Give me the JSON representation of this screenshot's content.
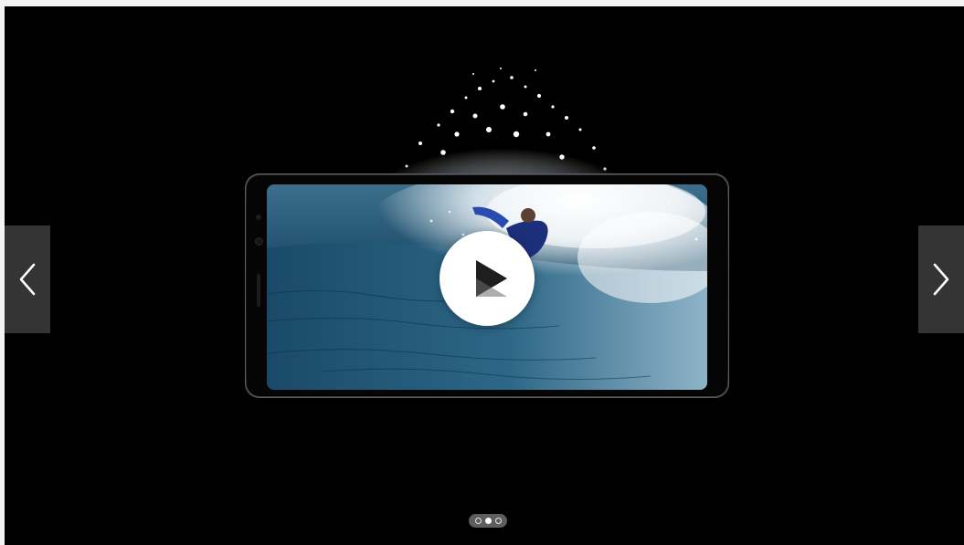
{
  "carousel": {
    "prev_icon": "chevron-left-icon",
    "next_icon": "chevron-right-icon",
    "play_icon": "play-icon",
    "slide": {
      "image": "surfer-on-wave-on-smartphone-screen"
    },
    "pagination": {
      "count": 3,
      "active_index": 1
    }
  },
  "colors": {
    "background": "#000000",
    "nav_button": "#3a3a3a",
    "play_button": "#ffffff"
  }
}
